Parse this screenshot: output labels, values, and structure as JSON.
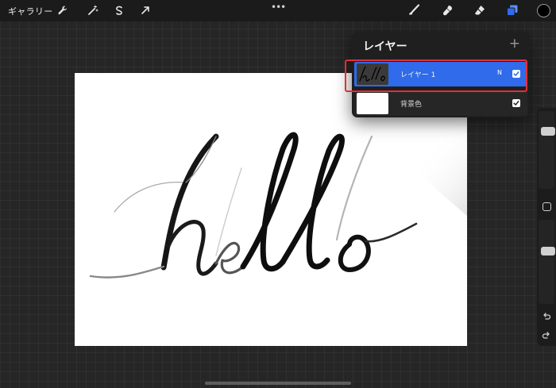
{
  "toolbar": {
    "gallery_label": "ギャラリー",
    "left_icons": [
      "wrench-icon",
      "magic-wand-icon",
      "selection-icon",
      "transform-icon"
    ],
    "right_icons": [
      "brush-icon",
      "smudge-icon",
      "eraser-icon",
      "layers-icon"
    ],
    "active_tool": "layers-icon",
    "accent_color": "#2f6bea",
    "current_color": "#000000"
  },
  "canvas": {
    "artwork_text": "hello",
    "background_color": "#ffffff"
  },
  "layers_panel": {
    "title": "レイヤー",
    "add_symbol": "+",
    "layers": [
      {
        "name": "レイヤー 1",
        "blend_mode": "N",
        "visible": true,
        "selected": true,
        "thumbnail": "hello"
      },
      {
        "name": "背景色",
        "visible": true,
        "selected": false,
        "thumbnail": "white"
      }
    ]
  },
  "sidebar": {
    "brush_size_level": 0.22,
    "opacity_level": 0.35,
    "icons": [
      "modify-square-icon",
      "undo-icon",
      "redo-icon"
    ]
  }
}
